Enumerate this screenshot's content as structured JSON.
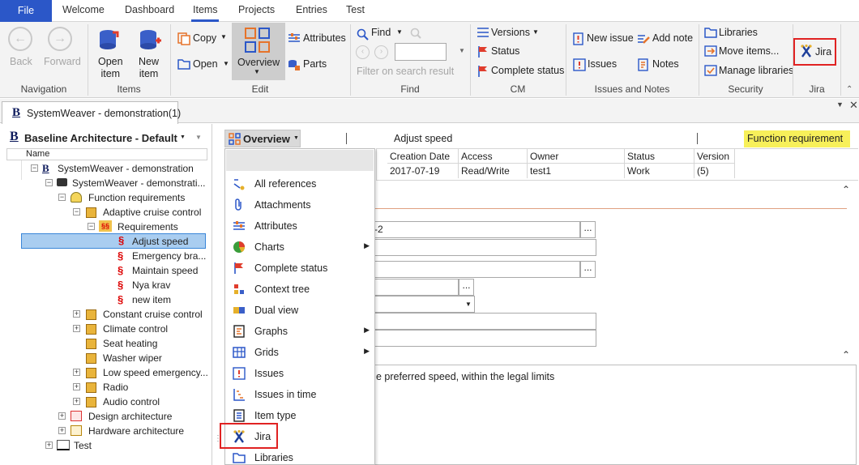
{
  "ribbon_tabs": [
    "File",
    "Welcome",
    "Dashboard",
    "Items",
    "Projects",
    "Entries",
    "Test"
  ],
  "ribbon": {
    "navigation": {
      "back": "Back",
      "forward": "Forward",
      "group": "Navigation"
    },
    "items": {
      "open_item": "Open\nitem",
      "new_item": "New\nitem",
      "group": "Items"
    },
    "edit": {
      "copy": "Copy",
      "open": "Open",
      "overview": "Overview",
      "attributes": "Attributes",
      "parts": "Parts",
      "group": "Edit"
    },
    "find": {
      "find": "Find",
      "filter": "Filter on search result",
      "group": "Find"
    },
    "cm": {
      "versions": "Versions",
      "status": "Status",
      "complete_status": "Complete status",
      "group": "CM"
    },
    "issues_notes": {
      "new_issue": "New issue",
      "add_note": "Add note",
      "issues": "Issues",
      "notes": "Notes",
      "group": "Issues and Notes"
    },
    "security": {
      "libraries": "Libraries",
      "move_items": "Move items...",
      "manage_libraries": "Manage libraries",
      "group": "Security"
    },
    "jira": {
      "jira": "Jira",
      "group": "Jira"
    }
  },
  "doc_tab": "SystemWeaver - demonstration(1)",
  "tree": {
    "title": "Baseline Architecture - Default",
    "column": "Name",
    "nodes": [
      "SystemWeaver - demonstration",
      "SystemWeaver - demonstrati...",
      "Function requirements",
      "Adaptive cruise control",
      "Requirements",
      "Adjust speed",
      "Emergency bra...",
      "Maintain speed",
      "Nya krav",
      "new item",
      "Constant cruise control",
      "Climate control",
      "Seat heating",
      "Washer wiper",
      "Low speed emergency...",
      "Radio",
      "Audio control",
      "Design architecture",
      "Hardware architecture",
      "Test"
    ]
  },
  "content": {
    "view": "Overview",
    "item_name": "Adjust speed",
    "item_type": "Function requirement",
    "headers": [
      "Creation Date",
      "Access",
      "Owner",
      "Status",
      "Version"
    ],
    "values": [
      "2017-07-19",
      "Read/Write",
      "test1",
      "Work",
      "(5)"
    ],
    "field_fragment": "-2",
    "description": "e preferred speed, within the legal limits"
  },
  "menu": [
    "All references",
    "Attachments",
    "Attributes",
    "Charts",
    "Complete status",
    "Context tree",
    "Dual view",
    "Graphs",
    "Grids",
    "Issues",
    "Issues in time",
    "Item type",
    "Jira",
    "Libraries"
  ]
}
